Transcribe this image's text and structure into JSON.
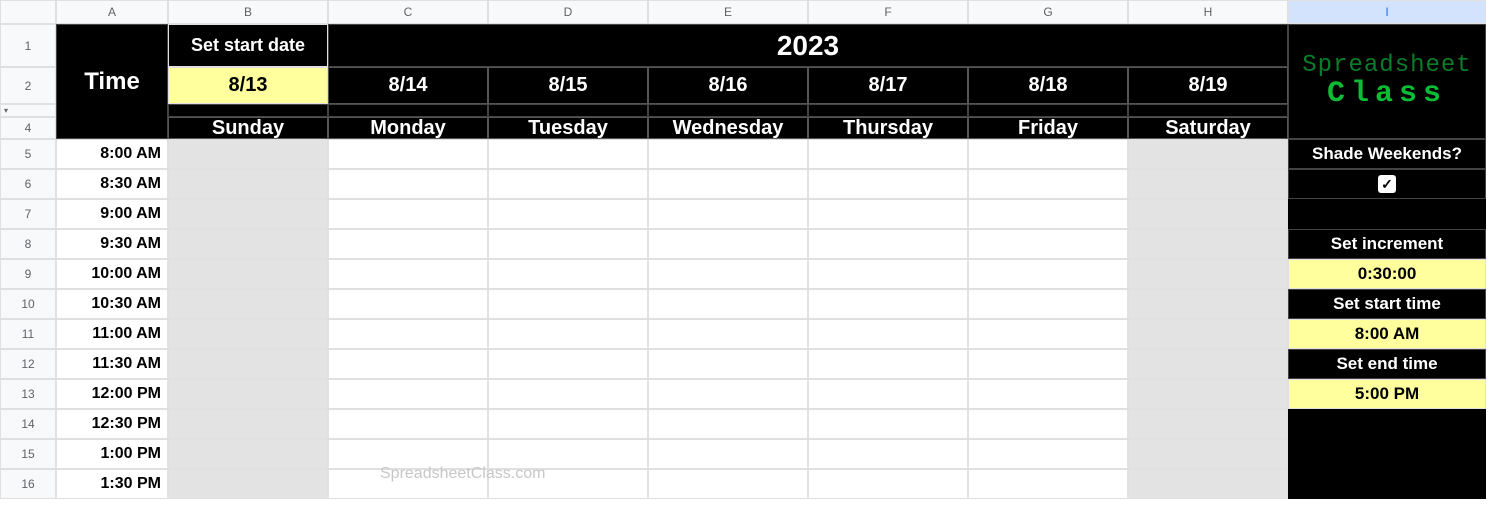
{
  "columns": [
    "A",
    "B",
    "C",
    "D",
    "E",
    "F",
    "G",
    "H",
    "I"
  ],
  "rows": [
    "1",
    "2",
    "3",
    "4",
    "5",
    "6",
    "7",
    "8",
    "9",
    "10",
    "11",
    "12",
    "13",
    "14",
    "15",
    "16"
  ],
  "header": {
    "time_label": "Time",
    "set_start_date_label": "Set start date",
    "year": "2023",
    "logo_line1": "Spreadsheet",
    "logo_line2": "Class"
  },
  "dates": [
    "8/13",
    "8/14",
    "8/15",
    "8/16",
    "8/17",
    "8/18",
    "8/19"
  ],
  "days": [
    "Sunday",
    "Monday",
    "Tuesday",
    "Wednesday",
    "Thursday",
    "Friday",
    "Saturday"
  ],
  "times": [
    "8:00 AM",
    "8:30 AM",
    "9:00 AM",
    "9:30 AM",
    "10:00 AM",
    "10:30 AM",
    "11:00 AM",
    "11:30 AM",
    "12:00 PM",
    "12:30 PM",
    "1:00 PM",
    "1:30 PM"
  ],
  "sidebar": {
    "shade_weekends_label": "Shade Weekends?",
    "shade_weekends_checked": "✓",
    "set_increment_label": "Set increment",
    "increment_value": "0:30:00",
    "set_start_time_label": "Set start time",
    "start_time_value": "8:00 AM",
    "set_end_time_label": "Set end time",
    "end_time_value": "5:00 PM"
  },
  "watermark": "SpreadsheetClass.com",
  "shaded_day_indices": [
    0,
    6
  ],
  "chart_data": {
    "type": "table",
    "title": "Weekly schedule template",
    "year": 2023,
    "start_date": "8/13",
    "days": [
      "Sunday",
      "Monday",
      "Tuesday",
      "Wednesday",
      "Thursday",
      "Friday",
      "Saturday"
    ],
    "dates": [
      "8/13",
      "8/14",
      "8/15",
      "8/16",
      "8/17",
      "8/18",
      "8/19"
    ],
    "time_increment": "0:30:00",
    "time_start": "8:00 AM",
    "time_end": "5:00 PM",
    "times_shown": [
      "8:00 AM",
      "8:30 AM",
      "9:00 AM",
      "9:30 AM",
      "10:00 AM",
      "10:30 AM",
      "11:00 AM",
      "11:30 AM",
      "12:00 PM",
      "12:30 PM",
      "1:00 PM",
      "1:30 PM"
    ],
    "shade_weekends": true
  }
}
